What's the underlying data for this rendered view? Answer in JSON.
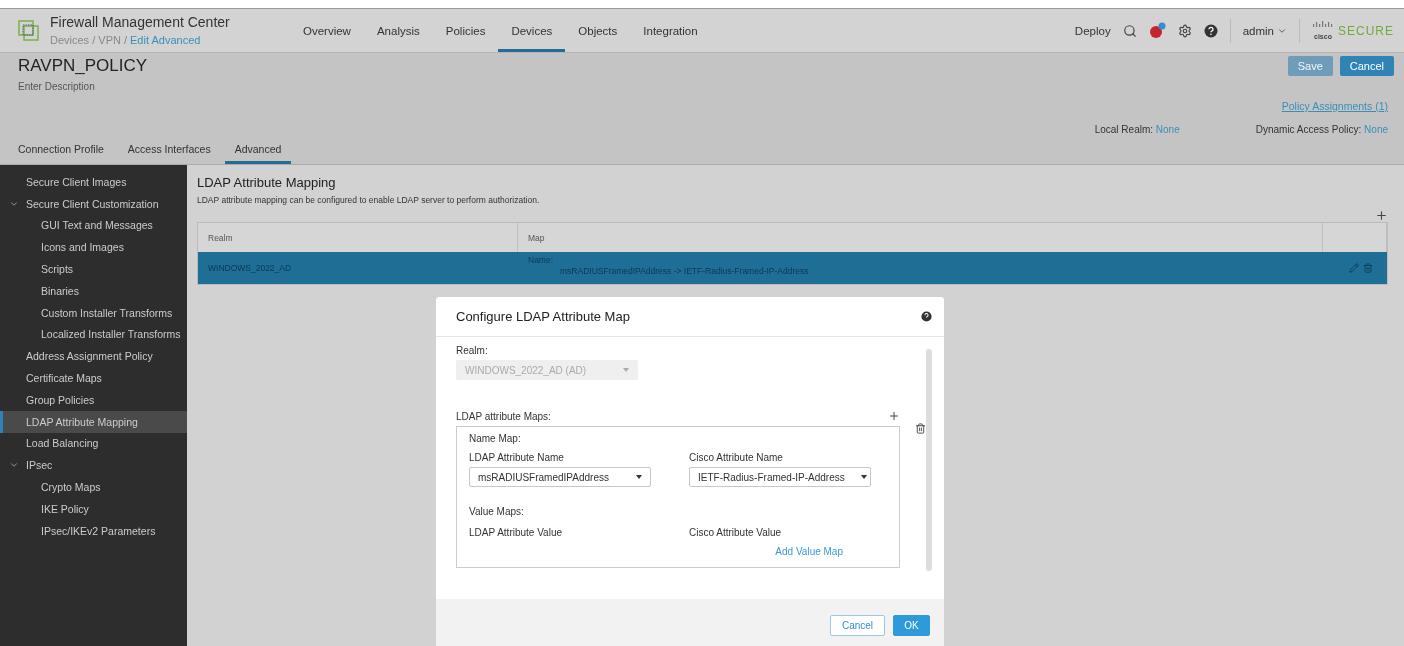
{
  "header": {
    "title": "Firewall Management Center",
    "breadcrumb": {
      "path": "Devices / VPN /",
      "current": "Edit Advanced"
    },
    "nav": [
      {
        "label": "Overview",
        "selected": false
      },
      {
        "label": "Analysis",
        "selected": false
      },
      {
        "label": "Policies",
        "selected": false
      },
      {
        "label": "Devices",
        "selected": true
      },
      {
        "label": "Objects",
        "selected": false
      },
      {
        "label": "Integration",
        "selected": false
      }
    ],
    "deploy": "Deploy",
    "user": "admin",
    "logo": {
      "small": "cisco",
      "label": "SECURE"
    }
  },
  "policy": {
    "name": "RAVPN_POLICY",
    "description": "Enter Description",
    "buttons": [
      {
        "label": "Save",
        "disabled": true
      },
      {
        "label": "Cancel",
        "disabled": false
      }
    ],
    "assignments": "Policy Assignments (1)",
    "local_realm": {
      "label": "Local Realm:",
      "value": "None"
    },
    "dynamic_access_policy": {
      "label": "Dynamic Access Policy:",
      "value": "None"
    },
    "tabs": [
      {
        "label": "Connection Profile",
        "selected": false
      },
      {
        "label": "Access Interfaces",
        "selected": false
      },
      {
        "label": "Advanced",
        "selected": true
      }
    ]
  },
  "sidebar": {
    "items": [
      {
        "label": "Secure Client Images",
        "selected": false
      },
      {
        "label": "Secure Client Customization",
        "selected": false,
        "expanded": true,
        "children": [
          {
            "label": "GUI Text and Messages",
            "selected": false
          },
          {
            "label": "Icons and Images",
            "selected": false
          },
          {
            "label": "Scripts",
            "selected": false
          },
          {
            "label": "Binaries",
            "selected": false
          },
          {
            "label": "Custom Installer Transforms",
            "selected": false
          },
          {
            "label": "Localized Installer Transforms",
            "selected": false
          }
        ]
      },
      {
        "label": "Address Assignment Policy",
        "selected": false
      },
      {
        "label": "Certificate Maps",
        "selected": false
      },
      {
        "label": "Group Policies",
        "selected": false
      },
      {
        "label": "LDAP Attribute Mapping",
        "selected": true
      },
      {
        "label": "Load Balancing",
        "selected": false
      },
      {
        "label": "IPsec",
        "selected": false,
        "expanded": true,
        "children": [
          {
            "label": "Crypto Maps",
            "selected": false
          },
          {
            "label": "IKE Policy",
            "selected": false
          },
          {
            "label": "IPsec/IKEv2 Parameters",
            "selected": false
          }
        ]
      }
    ]
  },
  "content": {
    "title": "LDAP Attribute Mapping",
    "description": "LDAP attribute mapping can be configured to enable LDAP server to perform authorization.",
    "table": {
      "columns": [
        "Realm",
        "Map"
      ],
      "rows": [
        {
          "realm": "WINDOWS_2022_AD",
          "map_label": "Name:",
          "map_value": "msRADIUSFramedIPAddress -> IETF-Radius-Framed-IP-Address",
          "selected": true
        }
      ]
    }
  },
  "dialog": {
    "title": "Configure LDAP Attribute Map",
    "realm": {
      "label": "Realm:",
      "value": "WINDOWS_2022_AD (AD)",
      "disabled": true
    },
    "maps_label": "LDAP attribute Maps:",
    "name_map": "Name Map:",
    "ldap_attribute_name": {
      "label": "LDAP Attribute Name",
      "value": "msRADIUSFramedIPAddress"
    },
    "cisco_attribute_name": {
      "label": "Cisco Attribute Name",
      "value": "IETF-Radius-Framed-IP-Address"
    },
    "value_maps": "Value Maps:",
    "ldap_attribute_value": "LDAP Attribute Value",
    "cisco_attribute_value": "Cisco Attribute Value",
    "add_value_map": "Add Value Map",
    "buttons": [
      {
        "label": "Cancel",
        "kind": "secondary"
      },
      {
        "label": "OK",
        "kind": "primary"
      }
    ]
  }
}
